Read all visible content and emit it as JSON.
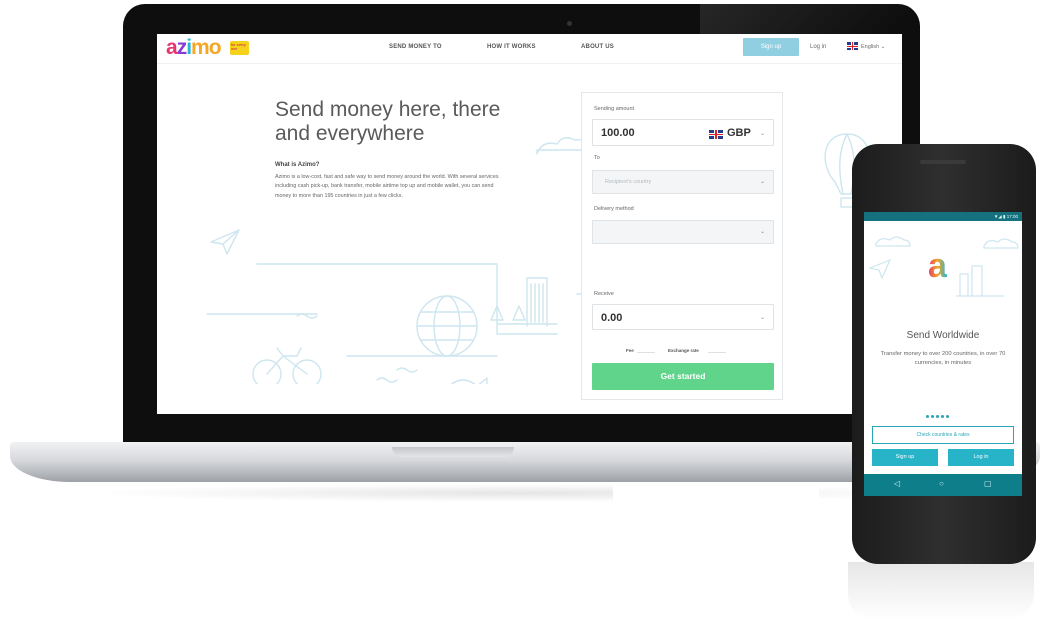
{
  "site": {
    "logo": {
      "parts": [
        "a",
        "z",
        "i",
        "mo"
      ],
      "tag": "for every one"
    },
    "nav": {
      "send_money": "SEND MONEY TO",
      "how_it_works": "HOW IT WORKS",
      "about": "ABOUT US"
    },
    "signup": "Sign up",
    "login": "Log in",
    "language": "English ⌄",
    "hero": {
      "title": "Send money here, there and everywhere",
      "what_title": "What is Azimo?",
      "what_body": "Azimo is a low-cost, fast and safe way to send money around the world. With several services including cash pick-up, bank transfer, mobile airtime top up and mobile wallet, you can send money to more than 195 countries in just a few clicks."
    },
    "form": {
      "sending_label": "Sending amount",
      "sending_value": "100.00",
      "currency": "GBP",
      "to_label": "To",
      "to_placeholder": "Recipient's country",
      "delivery_label": "Delivery method",
      "receive_label": "Receive",
      "receive_value": "0.00",
      "fee_label": "Fee",
      "rate_label": "Exchange rate",
      "cta": "Get started"
    },
    "colors": {
      "accent_blue": "#90cfe1",
      "cta_green": "#5fd48a",
      "teal": "#16717e"
    }
  },
  "phone": {
    "status": "▼◢ ▮ 17:00",
    "logo": "a",
    "title": "Send Worldwide",
    "subtitle": "Transfer money to over 200 countries, in over 70 currencies, in minutes",
    "outline_button": "Check countries & rates",
    "signup": "Sign up",
    "login": "Log in",
    "nav": {
      "back": "◁",
      "home": "○",
      "recent": "▢"
    }
  },
  "icons": [
    "plane-icon",
    "bicycle-icon",
    "globe-icon",
    "cloud-icon",
    "fish-icon",
    "balloon-icon",
    "chevron-down-icon"
  ]
}
